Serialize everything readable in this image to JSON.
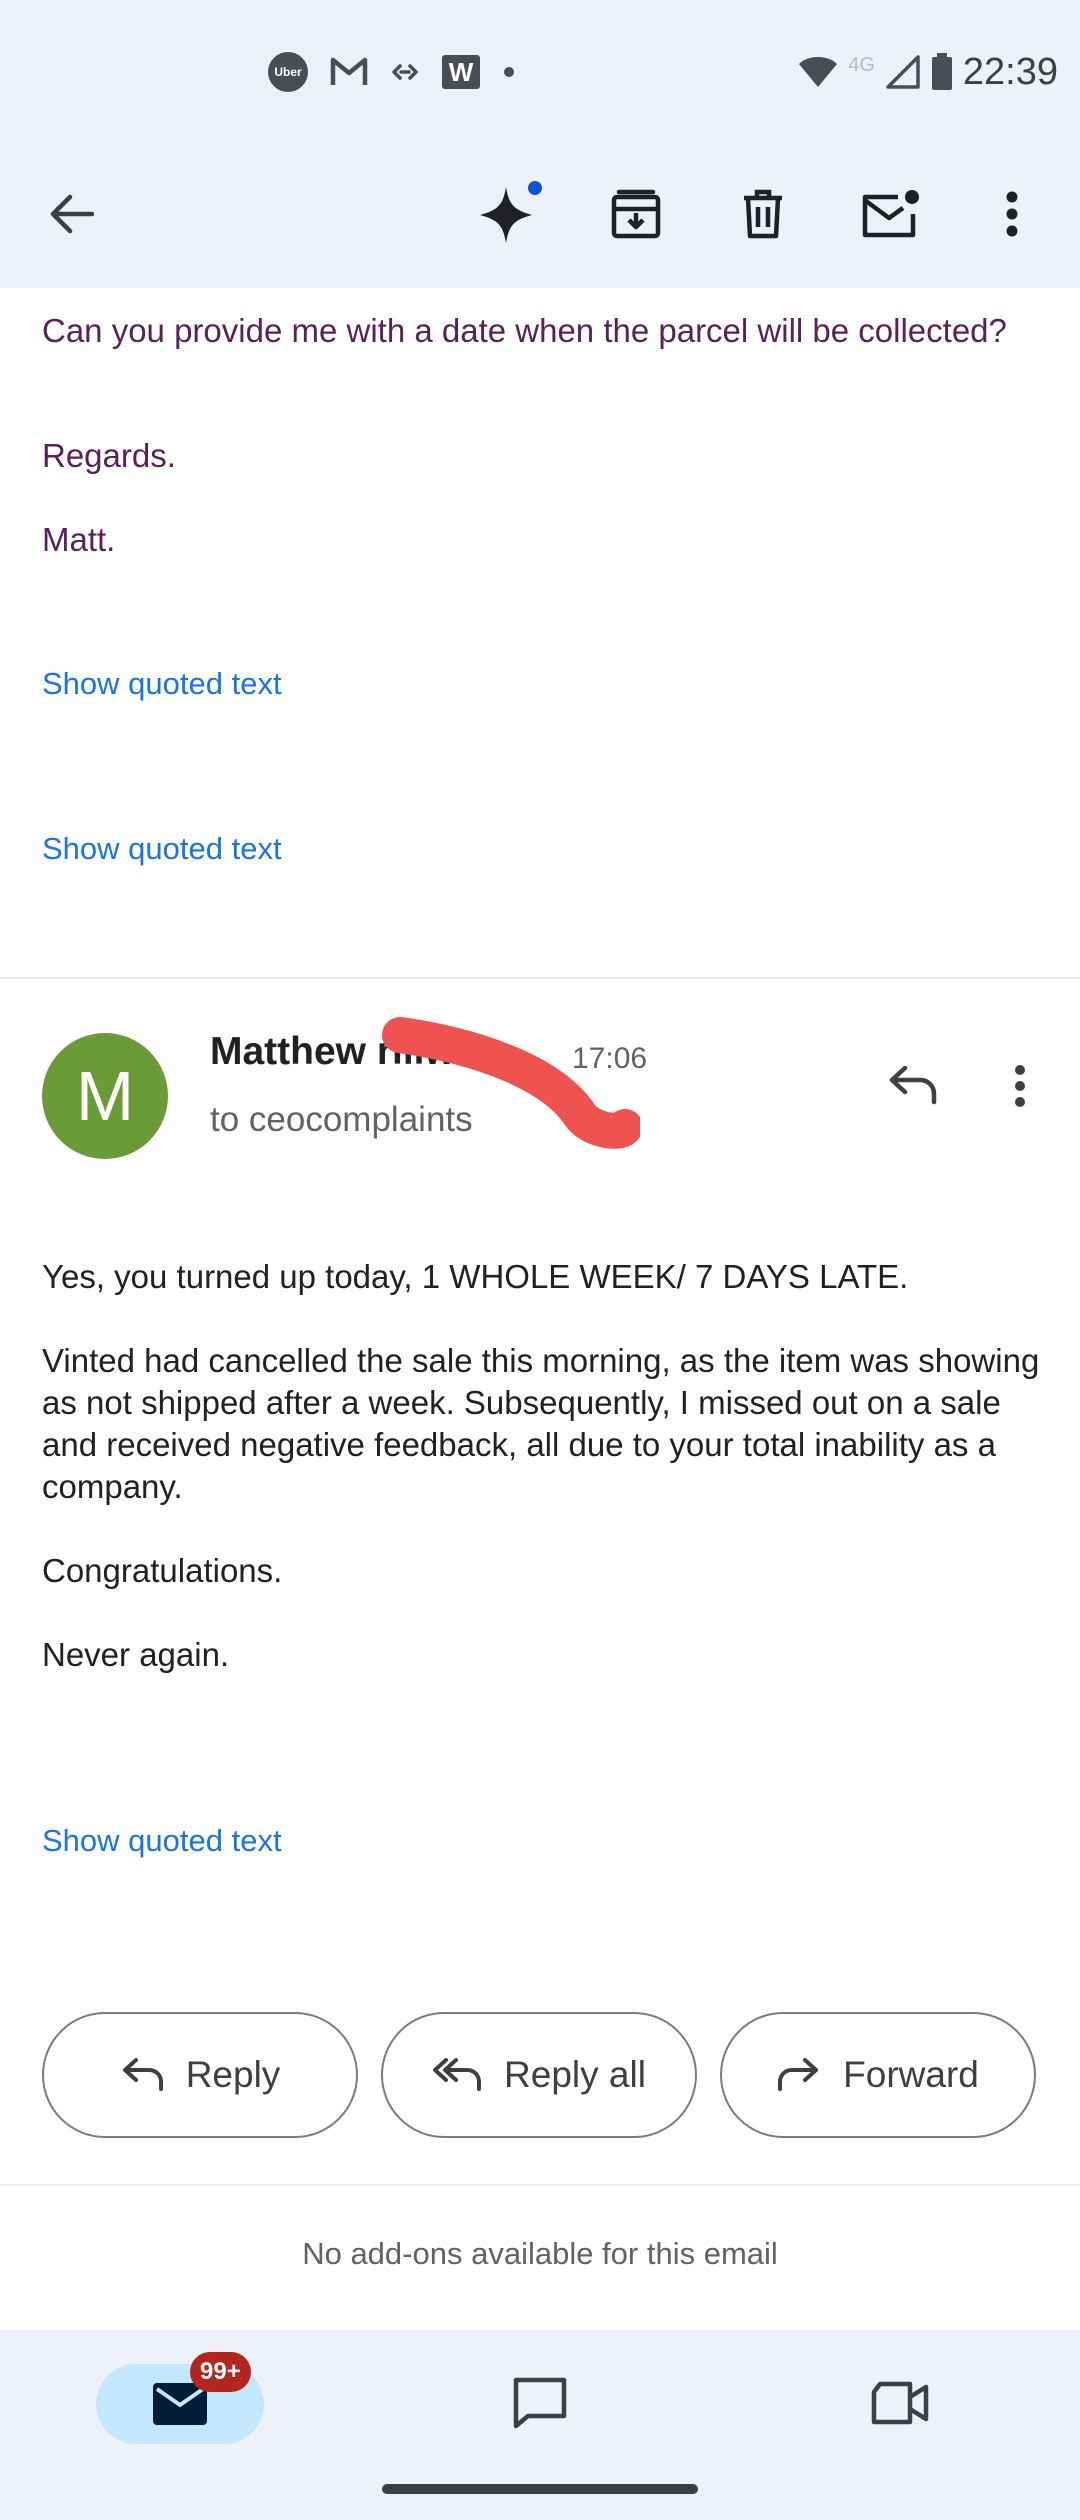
{
  "status_bar": {
    "time": "22:39",
    "network": "4G",
    "notification_icons": [
      "uber-icon",
      "gmail-icon",
      "link-icon",
      "w-app-icon",
      "dot-icon"
    ],
    "uber_label": "Uber",
    "w_label": "W"
  },
  "app_bar": {
    "actions": [
      "back",
      "gemini-sparkle",
      "archive",
      "delete",
      "mark-unread",
      "more"
    ]
  },
  "previous_message": {
    "line1": "Can you provide me with a date when the parcel will be collected?",
    "regards": "Regards.",
    "signature": "Matt.",
    "show_quoted_1": "Show quoted text",
    "show_quoted_2": "Show quoted text"
  },
  "message": {
    "avatar_letter": "M",
    "sender": "Matthew riliw",
    "time": "17:06",
    "recipient": "to ceocomplaints",
    "body": [
      "Yes, you turned up today, 1 WHOLE WEEK/ 7 DAYS LATE.",
      "Vinted had cancelled the sale this morning, as the item was showing as not shipped after a week. Subsequently, I missed out on a sale and received negative feedback, all due to your total inability as a company.",
      "Congratulations.",
      "Never again."
    ],
    "show_quoted": "Show quoted text"
  },
  "actions": {
    "reply": "Reply",
    "reply_all": "Reply all",
    "forward": "Forward"
  },
  "addons_text": "No add-ons available for this email",
  "bottom_nav": {
    "mail_badge": "99+",
    "items": [
      "mail-icon",
      "chat-icon",
      "meet-icon"
    ]
  },
  "colors": {
    "accent": "#1a73e8",
    "avatar": "#6b9b37",
    "quoted_text": "#5b1f5c",
    "badge": "#b3261e",
    "redaction": "#ef5350"
  }
}
